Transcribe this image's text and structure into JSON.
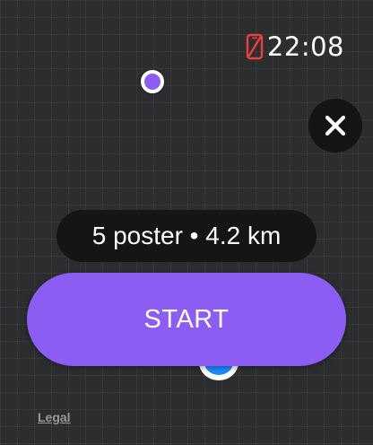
{
  "status_bar": {
    "time": "22:08",
    "connection_icon": "phone-disconnected-icon",
    "connection_icon_color": "#e8403a"
  },
  "map": {
    "point_color": "#8b5cf6",
    "user_location_color": "#1a8cff"
  },
  "close_button": {
    "icon": "close-icon"
  },
  "route_summary": {
    "text": "5 poster • 4.2 km"
  },
  "start_button": {
    "label": "START",
    "color": "#8c5df2"
  },
  "footer": {
    "legal_label": "Legal"
  }
}
